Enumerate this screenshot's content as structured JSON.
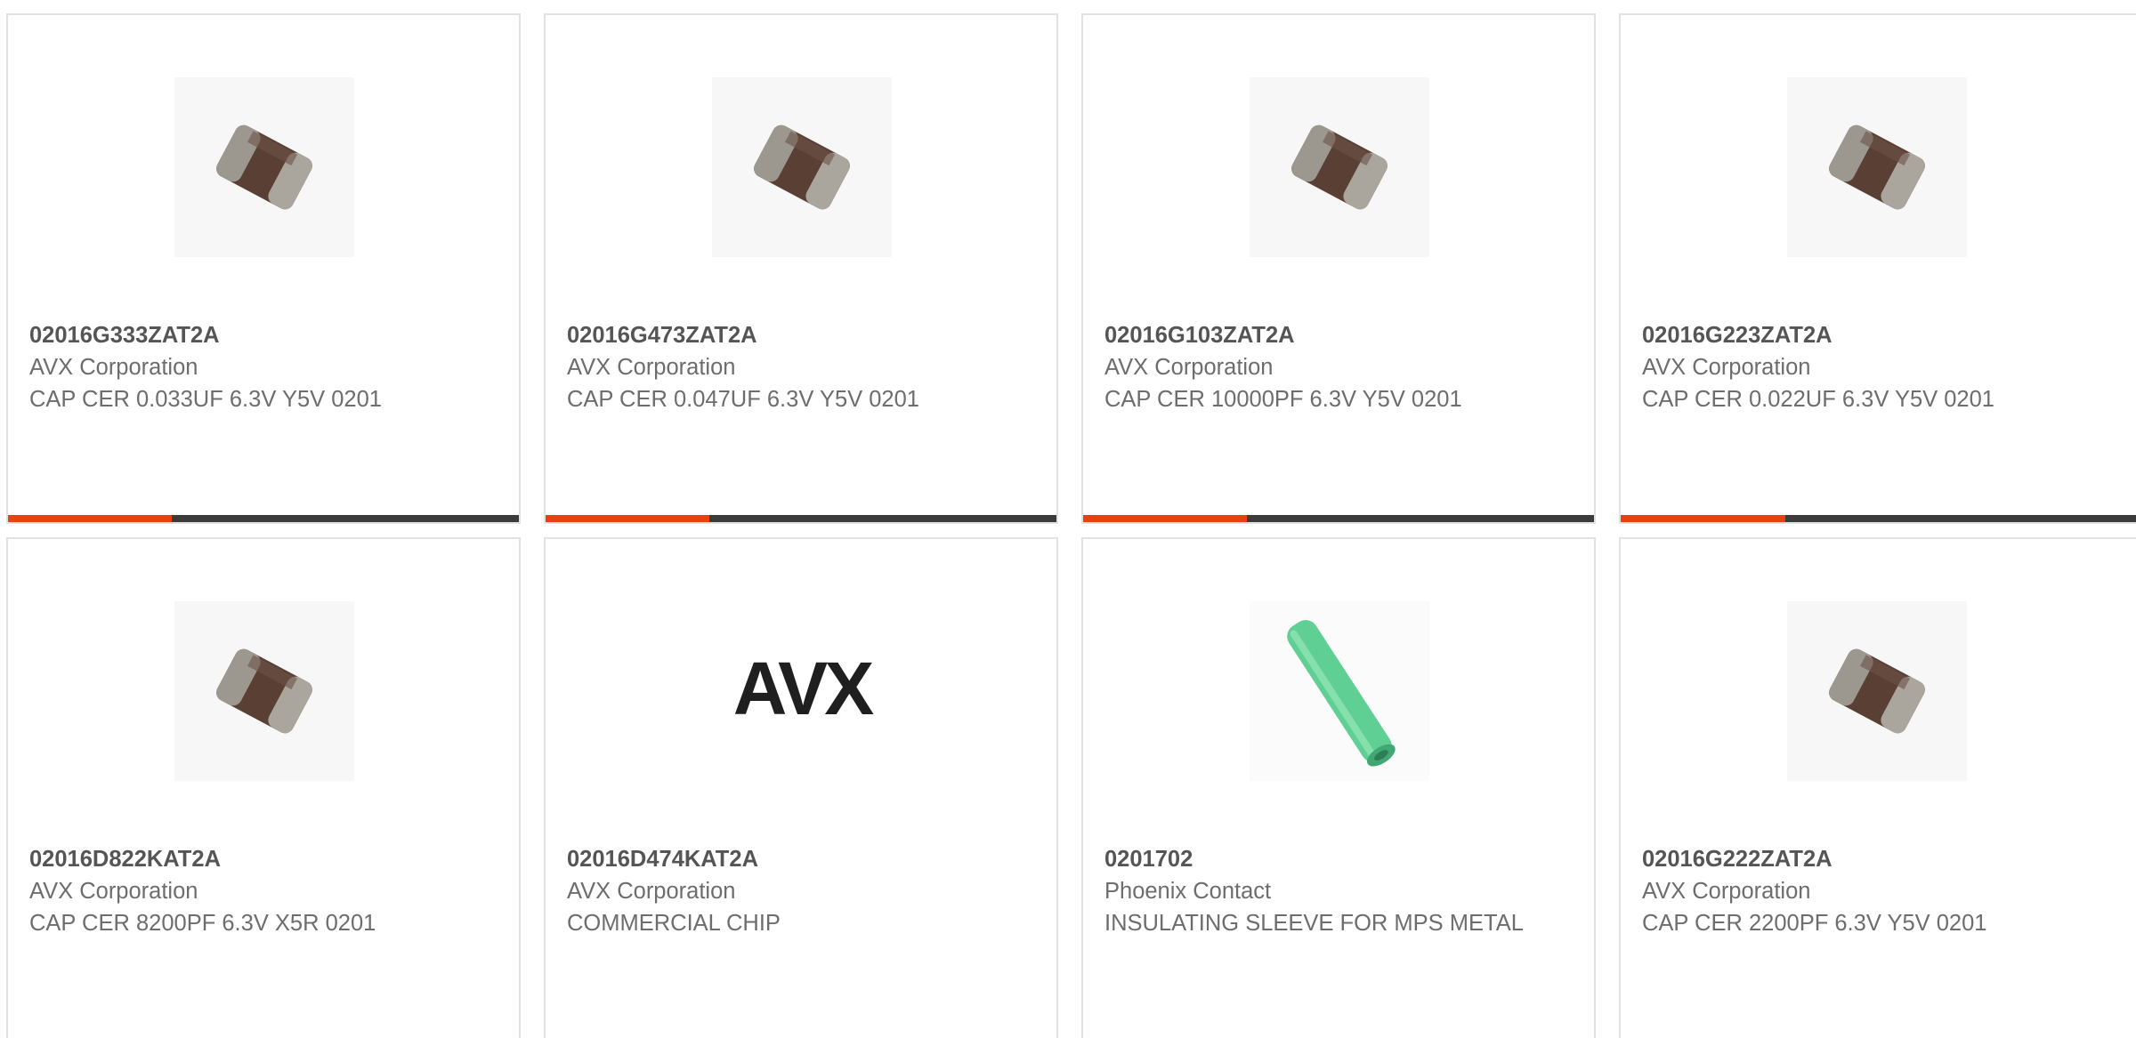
{
  "colors": {
    "accent": "#e8410f",
    "bar_track": "#3b3b3b",
    "card_border": "#e2e2e2",
    "part_text": "#555555",
    "body_text": "#6d6d6d"
  },
  "products": [
    {
      "part_number": "02016G333ZAT2A",
      "manufacturer": "AVX Corporation",
      "description": "CAP CER 0.033UF 6.3V Y5V 0201",
      "image": "ceramic-chip-capacitor-image",
      "bar_fill_fraction": 0.32
    },
    {
      "part_number": "02016G473ZAT2A",
      "manufacturer": "AVX Corporation",
      "description": "CAP CER 0.047UF 6.3V Y5V 0201",
      "image": "ceramic-chip-capacitor-image",
      "bar_fill_fraction": 0.32
    },
    {
      "part_number": "02016G103ZAT2A",
      "manufacturer": "AVX Corporation",
      "description": "CAP CER 10000PF 6.3V Y5V 0201",
      "image": "ceramic-chip-capacitor-image",
      "bar_fill_fraction": 0.32
    },
    {
      "part_number": "02016G223ZAT2A",
      "manufacturer": "AVX Corporation",
      "description": "CAP CER 0.022UF 6.3V Y5V 0201",
      "image": "ceramic-chip-capacitor-image",
      "bar_fill_fraction": 0.32
    },
    {
      "part_number": "02016D822KAT2A",
      "manufacturer": "AVX Corporation",
      "description": "CAP CER 8200PF 6.3V X5R 0201",
      "image": "ceramic-chip-capacitor-image"
    },
    {
      "part_number": "02016D474KAT2A",
      "manufacturer": "AVX Corporation",
      "description": "COMMERCIAL CHIP",
      "image": "avx-logo-image",
      "logo_text": "AVX"
    },
    {
      "part_number": "0201702",
      "manufacturer": "Phoenix Contact",
      "description": "INSULATING SLEEVE FOR MPS METAL",
      "image": "green-insulating-sleeve-image"
    },
    {
      "part_number": "02016G222ZAT2A",
      "manufacturer": "AVX Corporation",
      "description": "CAP CER 2200PF 6.3V Y5V 0201",
      "image": "ceramic-chip-capacitor-image"
    }
  ]
}
